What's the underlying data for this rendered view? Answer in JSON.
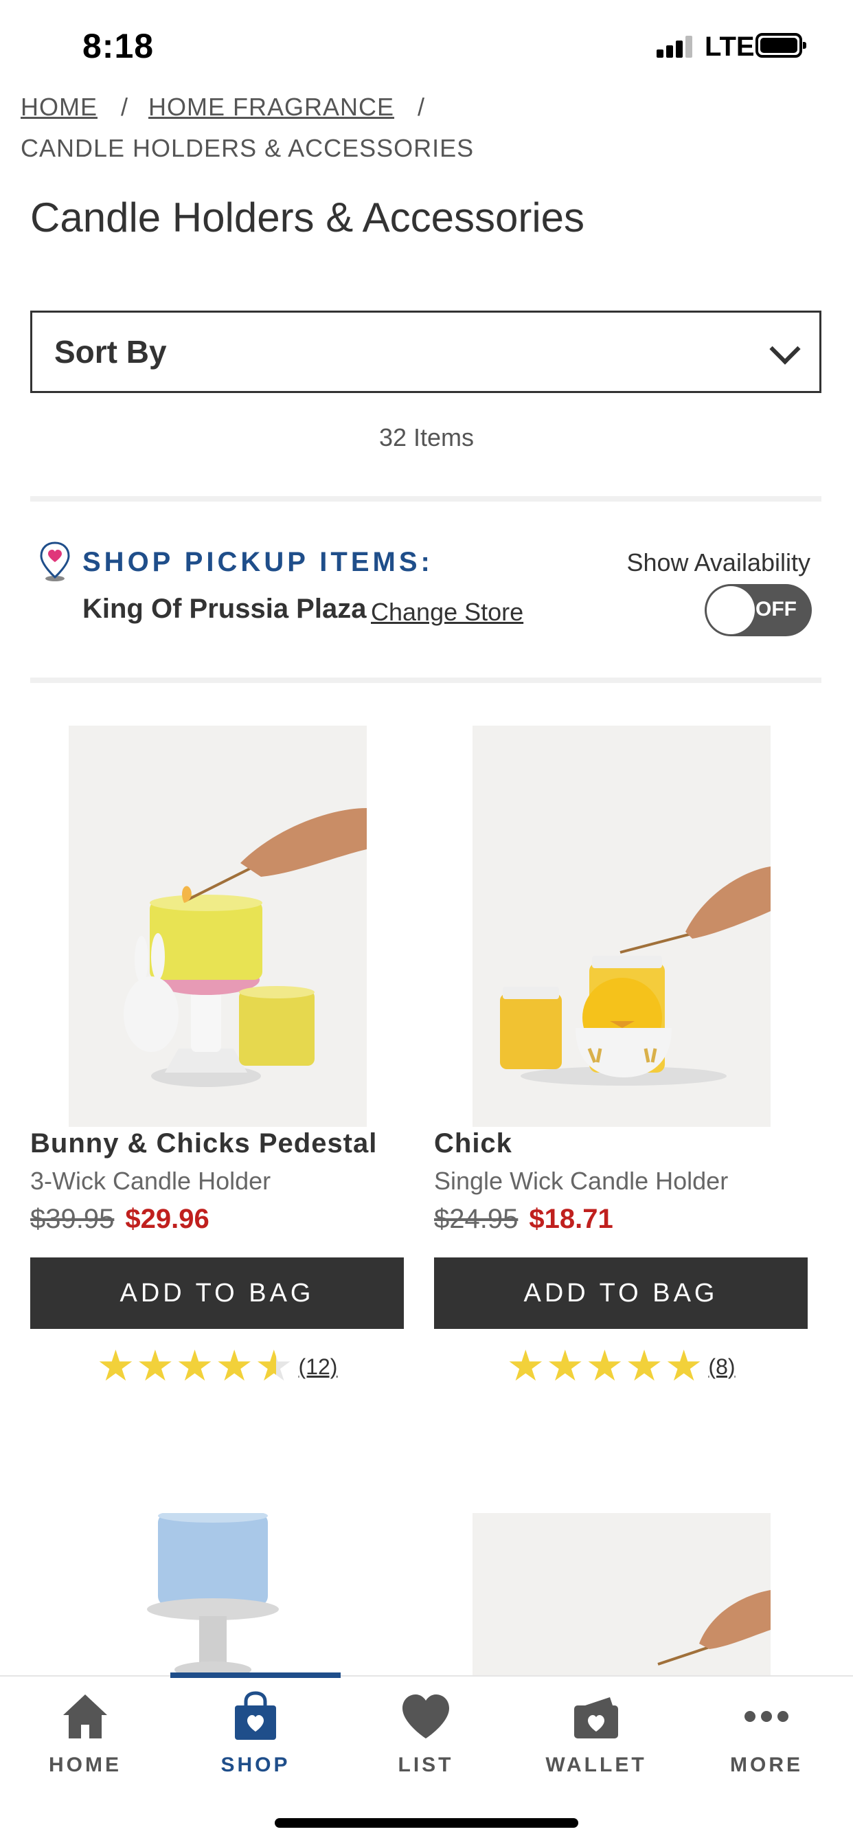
{
  "status_bar": {
    "time": "8:18",
    "network": "LTE"
  },
  "breadcrumb": {
    "items": [
      "HOME",
      "HOME FRAGRANCE"
    ],
    "separator": "/",
    "current": "CANDLE HOLDERS & ACCESSORIES"
  },
  "page": {
    "title": "Candle Holders & Accessories",
    "sort_label": "Sort By",
    "items_count": "32 Items"
  },
  "pickup": {
    "title": "SHOP PICKUP ITEMS:",
    "store_name": "King Of Prussia Plaza",
    "change_store": "Change Store",
    "show_availability": "Show Availability",
    "toggle_state": "OFF"
  },
  "products": [
    {
      "name": "Bunny & Chicks Pedestal",
      "subtitle": "3-Wick Candle Holder",
      "old_price": "$39.95",
      "price": "$29.96",
      "button": "ADD TO BAG",
      "rating": 4.5,
      "review_count": "(12)"
    },
    {
      "name": "Chick",
      "subtitle": "Single Wick Candle Holder",
      "old_price": "$24.95",
      "price": "$18.71",
      "button": "ADD TO BAG",
      "rating": 5,
      "review_count": "(8)"
    }
  ],
  "bottom_nav": {
    "items": [
      {
        "label": "HOME",
        "icon": "home-icon"
      },
      {
        "label": "SHOP",
        "icon": "shopping-bag-icon",
        "active": true
      },
      {
        "label": "LIST",
        "icon": "heart-icon"
      },
      {
        "label": "WALLET",
        "icon": "wallet-icon"
      },
      {
        "label": "MORE",
        "icon": "more-dots-icon"
      }
    ]
  },
  "colors": {
    "brand_blue": "#1f4e8a",
    "sale_red": "#c0201e",
    "star_yellow": "#f2d13a",
    "button_dark": "#333333"
  }
}
